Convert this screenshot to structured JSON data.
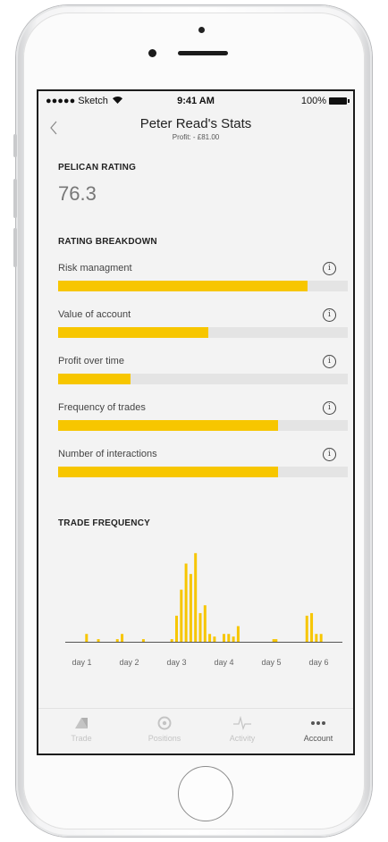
{
  "status_bar": {
    "carrier": "●●●●● Sketch",
    "wifi_icon": "wifi-icon",
    "time": "9:41 AM",
    "battery": "100%"
  },
  "header": {
    "back_icon": "chevron-left-icon",
    "title": "Peter Read's Stats",
    "subtitle": "Profit: - £81.00"
  },
  "pelican": {
    "label": "PELICAN RATING",
    "value": "76.3"
  },
  "breakdown": {
    "label": "RATING BREAKDOWN",
    "accent": "#f7c600",
    "items": [
      {
        "label": "Risk managment",
        "fill": 0.86
      },
      {
        "label": "Value of account",
        "fill": 0.52
      },
      {
        "label": "Profit over time",
        "fill": 0.25
      },
      {
        "label": "Frequency of trades",
        "fill": 0.76
      },
      {
        "label": "Number of interactions",
        "fill": 0.76
      }
    ]
  },
  "trade_frequency": {
    "label": "TRADE FREQUENCY"
  },
  "chart_data": {
    "type": "bar",
    "title": "TRADE FREQUENCY",
    "categories": [
      "day 1",
      "day 2",
      "day 3",
      "day 4",
      "day 5",
      "day 6"
    ],
    "values": [
      3,
      1,
      1,
      3,
      1,
      1,
      10,
      20,
      30,
      26,
      34,
      11,
      14,
      3,
      2,
      3,
      3,
      2,
      6,
      1,
      1,
      10,
      11,
      3,
      3
    ],
    "x": [
      1.1,
      1.35,
      1.75,
      1.85,
      2.3,
      2.9,
      3.0,
      3.1,
      3.2,
      3.3,
      3.4,
      3.5,
      3.6,
      3.7,
      3.8,
      4.0,
      4.1,
      4.2,
      4.3,
      5.05,
      5.1,
      5.75,
      5.85,
      5.95,
      6.05
    ],
    "xlabel": "",
    "ylabel": "",
    "ylim": [
      0,
      36
    ],
    "color": "#f7c600",
    "grid": false
  },
  "nav": {
    "items": [
      {
        "label": "Trade",
        "icon": "trade-icon",
        "active": false
      },
      {
        "label": "Positions",
        "icon": "positions-icon",
        "active": false
      },
      {
        "label": "Activity",
        "icon": "activity-icon",
        "active": false
      },
      {
        "label": "Account",
        "icon": "more-icon",
        "active": true
      }
    ]
  }
}
